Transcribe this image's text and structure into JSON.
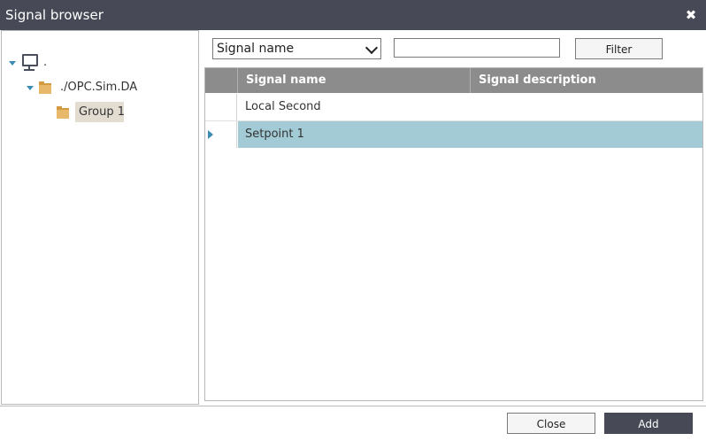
{
  "window": {
    "title": "Signal browser",
    "close_glyph": "✖"
  },
  "tree": {
    "root": {
      "label": ".",
      "icon": "computer-icon"
    },
    "server": {
      "label": "./OPC.Sim.DA",
      "icon": "folder-icon"
    },
    "group": {
      "label": "Group 1",
      "icon": "folder-icon"
    }
  },
  "filter": {
    "field_selected": "Signal name",
    "field_options": [
      "Signal name"
    ],
    "text_value": "",
    "button_label": "Filter"
  },
  "table": {
    "columns": [
      "Signal name",
      "Signal description"
    ],
    "rows": [
      {
        "name": "Local Second",
        "description": "",
        "selected": false
      },
      {
        "name": "Setpoint 1",
        "description": "",
        "selected": true
      }
    ]
  },
  "footer": {
    "close_label": "Close",
    "add_label": "Add"
  },
  "colors": {
    "titlebar": "#474a56",
    "header": "#8c8c8c",
    "selected_row": "#a2cbd6",
    "accent": "#3b8bb5",
    "group_highlight": "#e3ddd1"
  }
}
